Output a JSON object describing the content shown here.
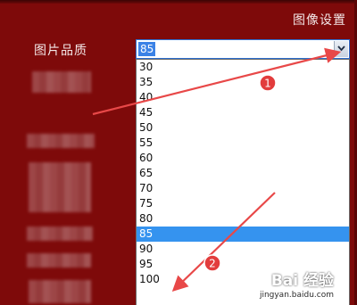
{
  "header": {
    "section_title": "图像设置"
  },
  "form": {
    "quality_label": "图片品质",
    "quality_select": {
      "selected_value": "85",
      "options": [
        "30",
        "35",
        "40",
        "45",
        "50",
        "55",
        "60",
        "65",
        "70",
        "75",
        "80",
        "85",
        "90",
        "95",
        "100"
      ],
      "highlighted_option": "85"
    }
  },
  "annotations": {
    "marker_1": "1",
    "marker_2": "2"
  },
  "watermark": {
    "brand": "Bai 经验",
    "url": "jingyan.baidu.com"
  },
  "colors": {
    "background": "#7e0a0a",
    "selection": "#3593ef",
    "annotation": "#e84848"
  },
  "icons": {
    "dropdown_arrow": "chevron-down-icon",
    "brand_mark": "paw-icon"
  }
}
